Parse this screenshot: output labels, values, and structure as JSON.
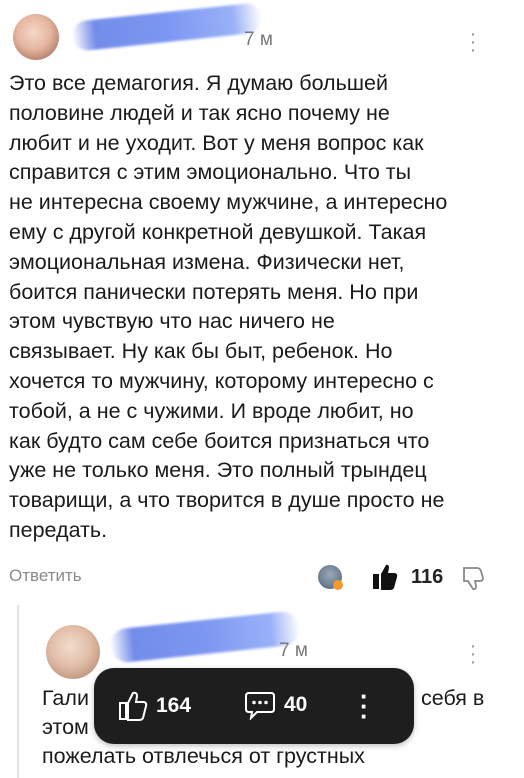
{
  "comment1": {
    "time": "7 м",
    "text": "Это все демагогия. Я думаю большей\nполовине людей и так ясно почему не\nлюбит и не уходит. Вот у меня вопрос как\nсправится с этим эмоционально. Что ты\nне интересна своему мужчине, а интересно\nему с другой конкретной девушкой. Такая\nэмоциональная измена. Физически нет,\nбоится панически потерять меня. Но при\nэтом чувствую что нас ничего не\nсвязывает. Ну как бы быт, ребенок. Но\nхочется то мужчину, которому интересно с\nтобой, а не с чужими. И вроде любит, но\nкак будто сам себе боится признаться что\nуже не только меня. Это полный трындец\nтоварищи, а что творится в душе просто не\nпередать.",
    "reply_label": "Ответить",
    "likes": "116"
  },
  "comment2": {
    "time": "7 м",
    "text_line1_start": "Гали",
    "text_line1_end": "себя в",
    "text_line2_start": "этом",
    "text_line3": "пожелать отвлечься от грустных"
  },
  "overlay": {
    "likes": "164",
    "comments": "40"
  },
  "colors": {
    "scribble": "#6a8ae8",
    "overlay_bg": "#1e1e1e"
  }
}
